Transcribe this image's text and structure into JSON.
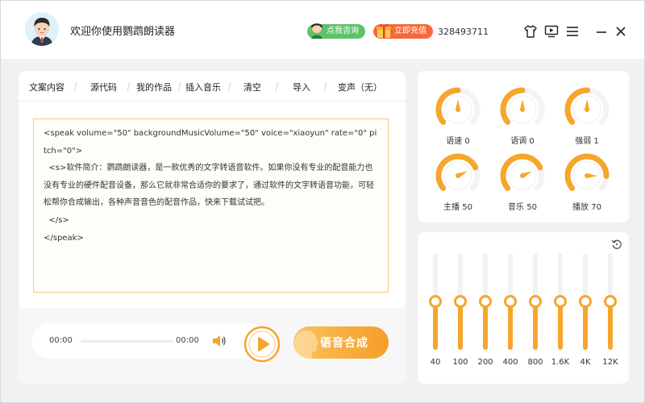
{
  "header": {
    "title": "欢迎你使用鹦鹉朗读器",
    "consult_label": "点我咨询",
    "recharge_label": "立即充值",
    "user_id": "328493711",
    "icons": [
      "shirt-icon",
      "screen-icon",
      "menu-icon",
      "minimize-icon",
      "close-icon"
    ]
  },
  "tabs": [
    {
      "label": "文案内容"
    },
    {
      "label": "源代码"
    },
    {
      "label": "我的作品"
    },
    {
      "label": "插入音乐"
    },
    {
      "label": "清空"
    },
    {
      "label": "导入"
    },
    {
      "label": "变声（无）"
    }
  ],
  "editor": {
    "content": "<speak volume=\"50\" backgroundMusicVolume=\"50\" voice=\"xiaoyun\" rate=\"0\" pitch=\"0\">\n  <s>软件简介：鹦鹉朗读器，是一款优秀的文字转语音软件。如果你没有专业的配音能力也没有专业的硬件配音设备，那么它就非常合适你的要求了，通过软件的文字转语音功能，可轻松帮你合成输出，各种声音音色的配音作品，快来下载试试把。\n  </s>\n</speak>"
  },
  "player": {
    "current_time": "00:00",
    "total_time": "00:00",
    "progress": 0,
    "synth_label": "语音合成"
  },
  "knobs": [
    {
      "name": "语速",
      "value": 0,
      "label": "语速 0"
    },
    {
      "name": "语调",
      "value": 0,
      "label": "语调 0"
    },
    {
      "name": "强弱",
      "value": 1,
      "label": "强弱 1"
    },
    {
      "name": "主播",
      "value": 50,
      "label": "主播 50"
    },
    {
      "name": "音乐",
      "value": 50,
      "label": "音乐 50"
    },
    {
      "name": "播放",
      "value": 70,
      "label": "播放 70"
    }
  ],
  "equalizer": {
    "bands": [
      {
        "label": "40",
        "level": 0.5
      },
      {
        "label": "100",
        "level": 0.5
      },
      {
        "label": "200",
        "level": 0.5
      },
      {
        "label": "400",
        "level": 0.5
      },
      {
        "label": "800",
        "level": 0.5
      },
      {
        "label": "1.6K",
        "level": 0.5
      },
      {
        "label": "4K",
        "level": 0.5
      },
      {
        "label": "12K",
        "level": 0.5
      }
    ]
  },
  "colors": {
    "accent": "#f6a62c",
    "consult_green": "#5ec26a",
    "recharge_orange": "#f46a3c",
    "editor_border": "#f3c880"
  }
}
